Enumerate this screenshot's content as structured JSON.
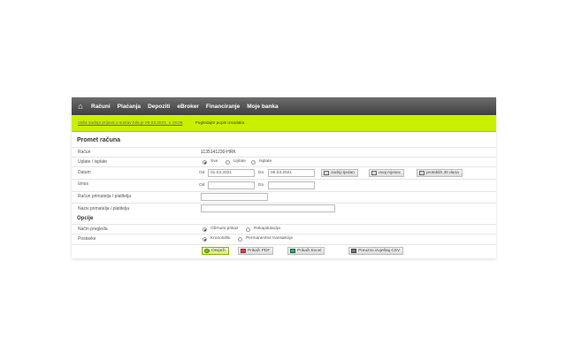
{
  "nav": {
    "items": [
      "Računi",
      "Plaćanja",
      "Depoziti",
      "eBroker",
      "Financiranje",
      "Moje banka"
    ]
  },
  "info": {
    "last_login_prefix": "Vaša zadnja prijava u sustav bila je 06.03.2021. u",
    "last_login_time": "15:06",
    "statements_link": "Pogledajte popis izvadaka"
  },
  "form": {
    "title": "Promet računa",
    "account_label": "Račun",
    "account_value": "1135141230-HRK",
    "type_label": "Uplate / isplate",
    "type_options": [
      "Sve",
      "Uplate",
      "Isplate"
    ],
    "date_label": "Datum",
    "from_label": "Od",
    "to_label": "Do",
    "date_from": "01.03.2021",
    "date_to": "06.03.2021",
    "btn_last_day": "zadnji tjedan",
    "btn_this_month": "ovaj mjesec",
    "btn_last_30": "proteklih 30 dana",
    "amount_label": "Iznos",
    "amount_from_label": "Od",
    "amount_to_label": "Do",
    "amount_from": "",
    "amount_to": "",
    "party_account_label": "Račun primatelja / platitelja",
    "party_name_label": "Naziv primatelja / platitelja",
    "party_account": "",
    "party_name": ""
  },
  "options": {
    "title": "Opcije",
    "sort_label": "Način pregleda",
    "sort_options": [
      "Obrnuto prikaz",
      "Rekapitulacija"
    ],
    "display_label": "Postavke",
    "display_options": [
      "Kronološki",
      "Permanentne transakcije"
    ],
    "btn_show": "Osvježi",
    "btn_pdf": "Prikaži PDF",
    "btn_excel": "Prikaži Excel",
    "btn_csv": "Preuzmi izvještaj CSV"
  },
  "colors": {
    "nav_bg": "#4a4a4a",
    "info_bg": "#c8f000",
    "accent": "#9acd00"
  }
}
